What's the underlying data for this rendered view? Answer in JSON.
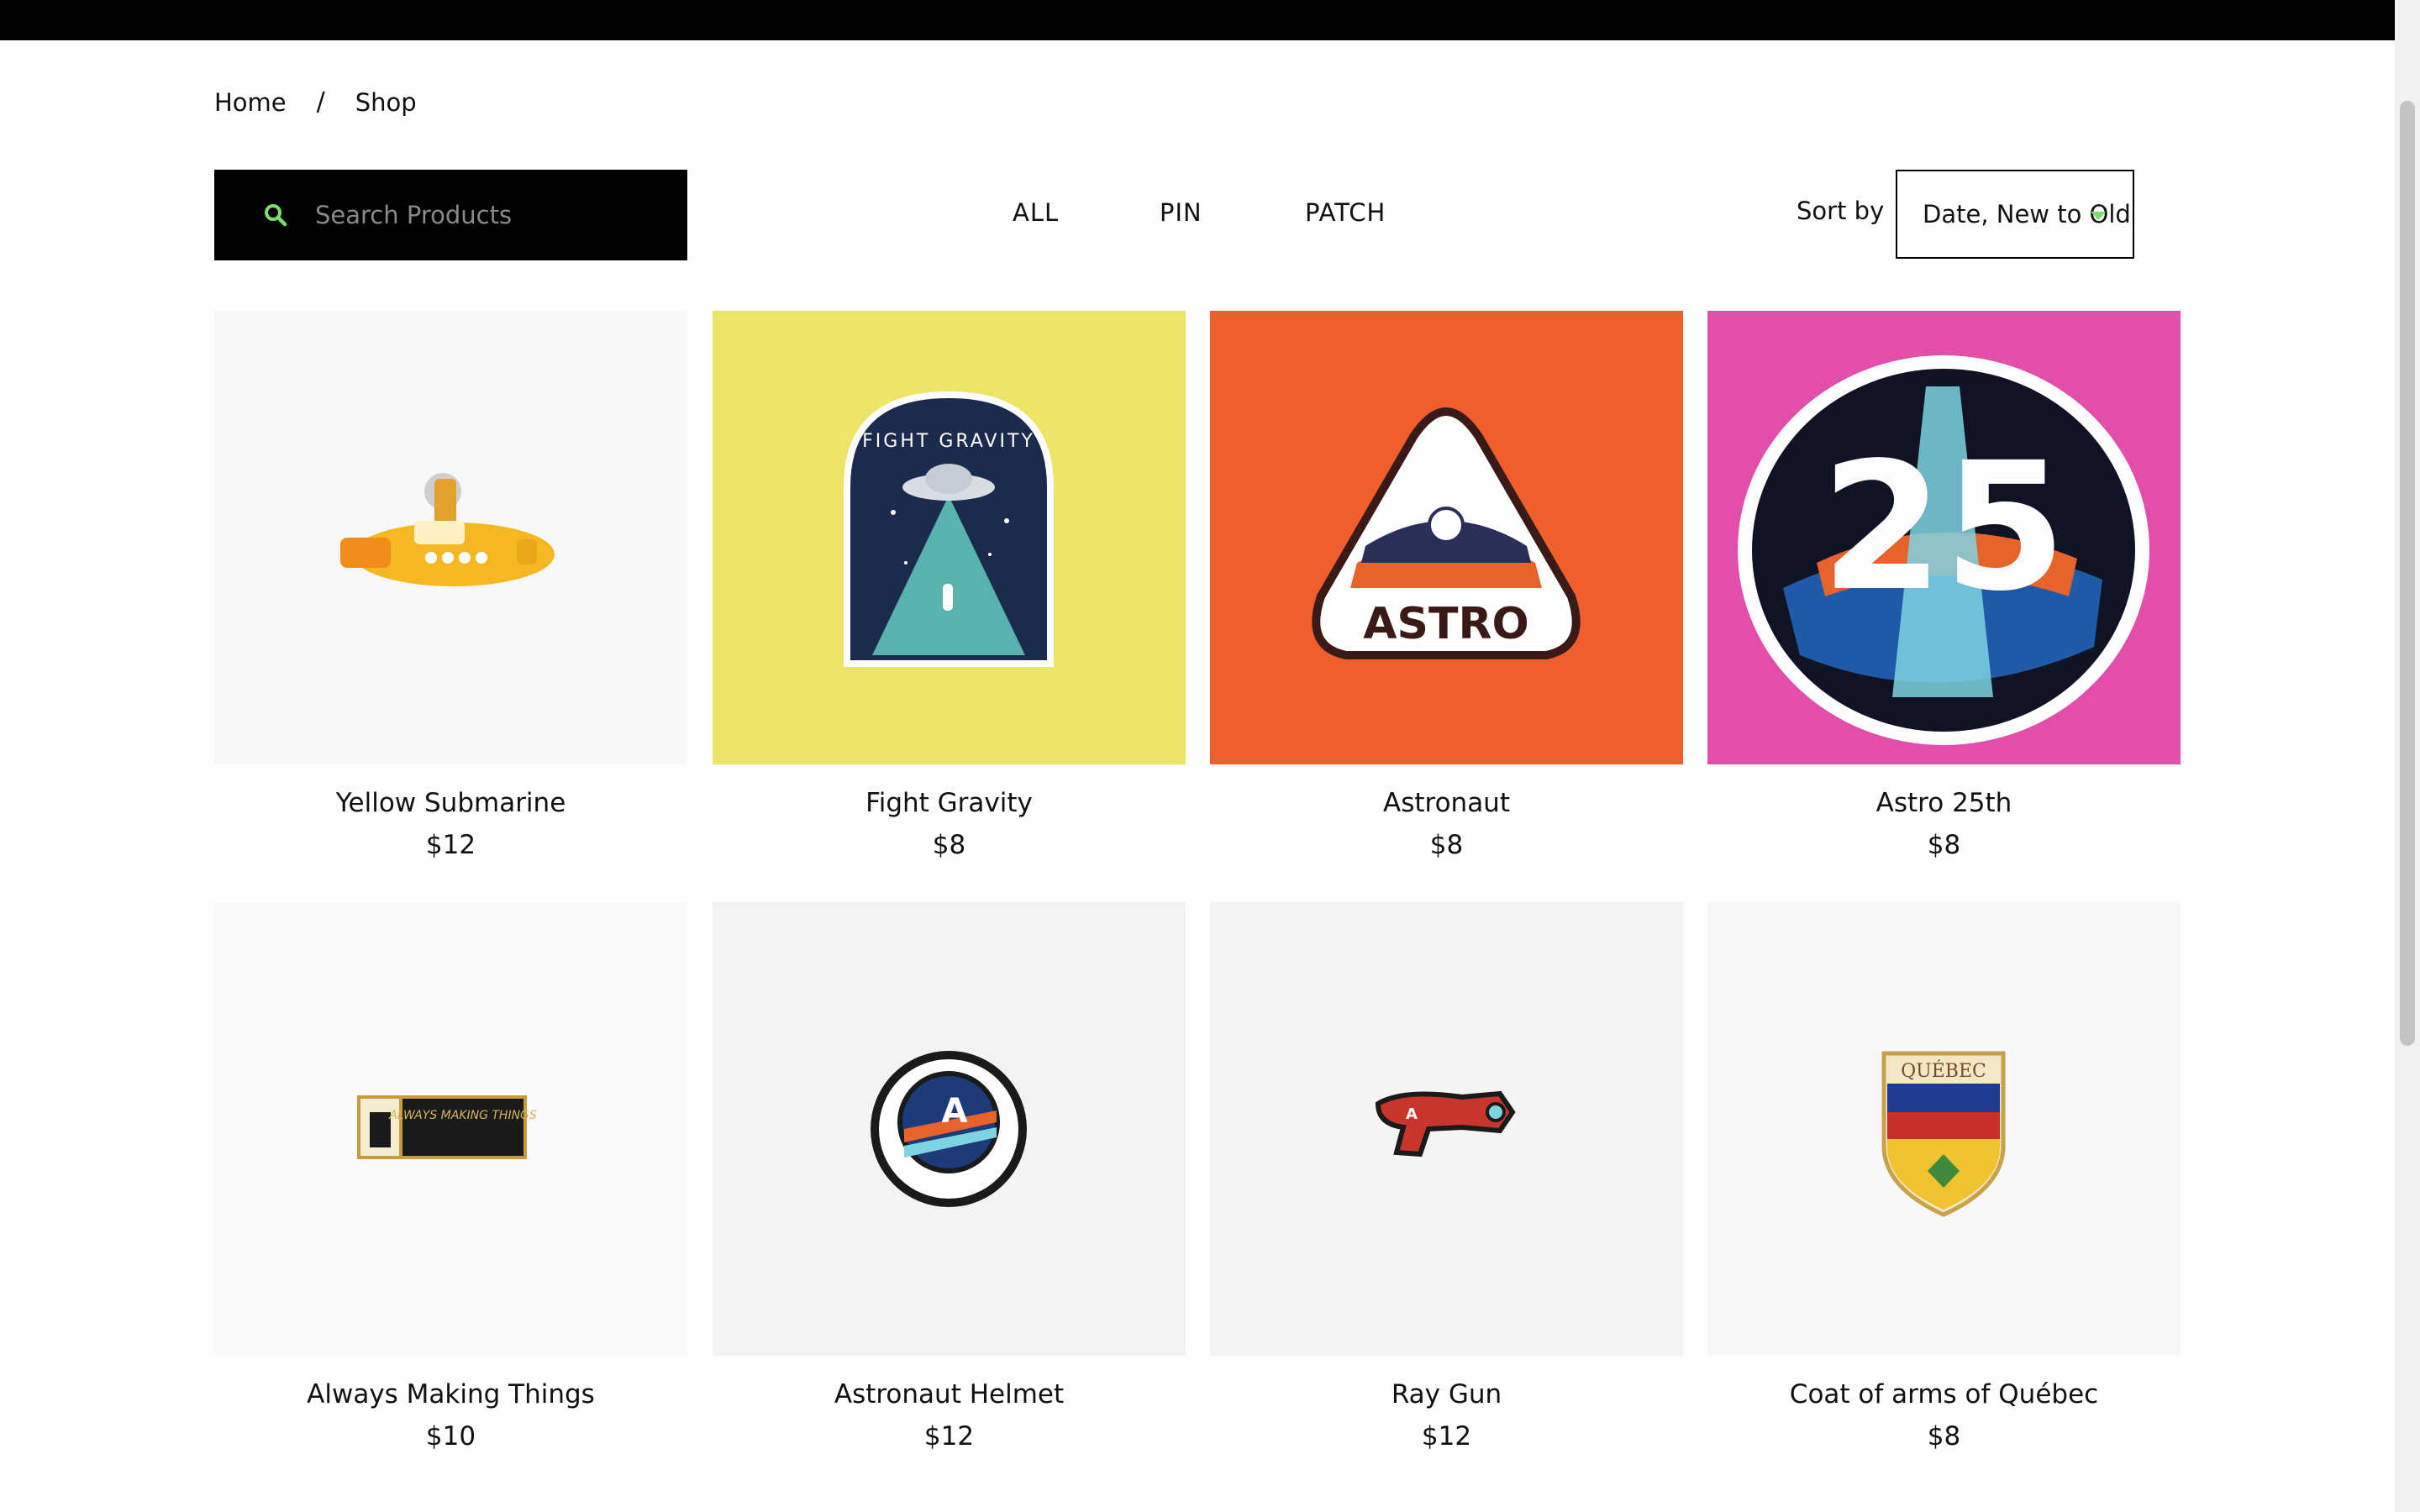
{
  "breadcrumb": {
    "home": "Home",
    "separator": "/",
    "shop": "Shop"
  },
  "search": {
    "placeholder": "Search Products",
    "icon": "search-icon",
    "icon_color": "#7ae06a"
  },
  "filters": [
    "ALL",
    "PIN",
    "PATCH"
  ],
  "sort": {
    "label": "Sort by",
    "selected": "Date, New to Old",
    "caret_color": "#7ae06a"
  },
  "products": [
    {
      "name": "Yellow Submarine",
      "price": "$12",
      "bg": "#f8f8f8"
    },
    {
      "name": "Fight Gravity",
      "price": "$8",
      "bg": "#efe46a",
      "patch_text": "FIGHT GRAVITY"
    },
    {
      "name": "Astronaut",
      "price": "$8",
      "bg": "#ef5e2c",
      "patch_text": "ASTRO"
    },
    {
      "name": "Astro 25th",
      "price": "$8",
      "bg": "#e24ea9",
      "patch_text": "25"
    },
    {
      "name": "Always Making Things",
      "price": "$10",
      "bg": "#fafafa",
      "patch_text": "ALWAYS MAKING THINGS"
    },
    {
      "name": "Astronaut Helmet",
      "price": "$12",
      "bg": "#f3f3f5",
      "patch_text": "A"
    },
    {
      "name": "Ray Gun",
      "price": "$12",
      "bg": "#f4f4f6",
      "patch_text": "A"
    },
    {
      "name": "Coat of arms of Québec",
      "price": "$8",
      "bg": "#f8f8f8",
      "patch_text": "QUÉBEC"
    }
  ]
}
